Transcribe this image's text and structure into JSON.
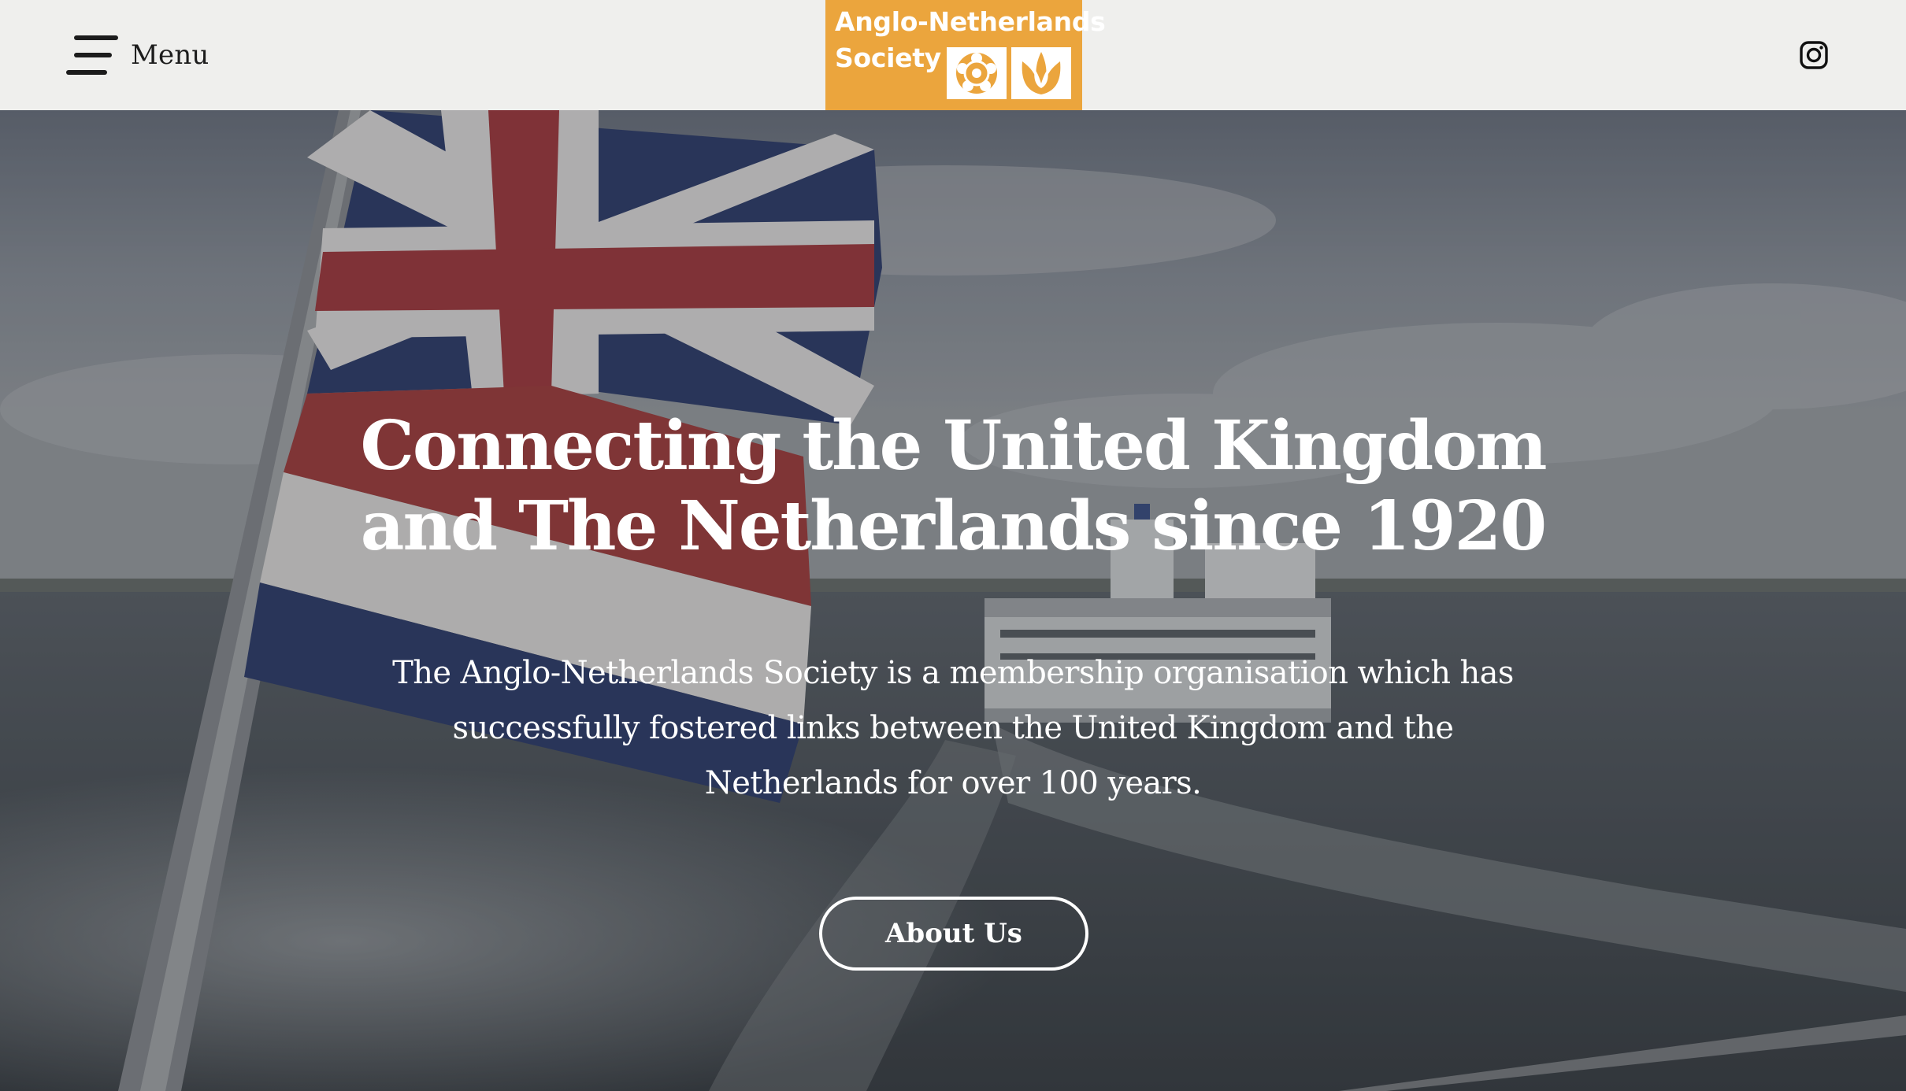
{
  "header": {
    "menu_label": "Menu",
    "logo_line1": "Anglo-Netherlands",
    "logo_line2": "Society",
    "logo_color": "#eba53d",
    "social_icon": "instagram-icon"
  },
  "hero": {
    "headline": "Connecting the United Kingdom and The Netherlands since 1920",
    "description": "The Anglo-Netherlands Society is a membership organisation which has successfully fostered links between the United Kingdom and the Netherlands for over 100 years.",
    "cta_label": "About Us",
    "background": "union-jack-and-dutch-flags-over-sea-with-ferry"
  }
}
